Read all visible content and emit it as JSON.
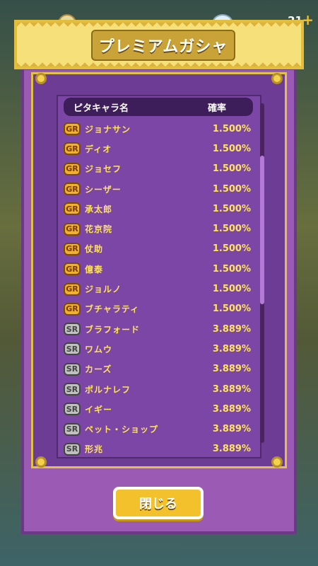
{
  "top": {
    "counter": "21"
  },
  "banner": {
    "title": "プレミアムガシャ"
  },
  "list": {
    "header_name": "ピタキャラ名",
    "header_rate": "確率",
    "items": [
      {
        "rank": "GR",
        "name": "ジョナサン",
        "rate": "1.500%"
      },
      {
        "rank": "GR",
        "name": "ディオ",
        "rate": "1.500%"
      },
      {
        "rank": "GR",
        "name": "ジョセフ",
        "rate": "1.500%"
      },
      {
        "rank": "GR",
        "name": "シーザー",
        "rate": "1.500%"
      },
      {
        "rank": "GR",
        "name": "承太郎",
        "rate": "1.500%"
      },
      {
        "rank": "GR",
        "name": "花京院",
        "rate": "1.500%"
      },
      {
        "rank": "GR",
        "name": "仗助",
        "rate": "1.500%"
      },
      {
        "rank": "GR",
        "name": "億泰",
        "rate": "1.500%"
      },
      {
        "rank": "GR",
        "name": "ジョルノ",
        "rate": "1.500%"
      },
      {
        "rank": "GR",
        "name": "ブチャラティ",
        "rate": "1.500%"
      },
      {
        "rank": "SR",
        "name": "ブラフォード",
        "rate": "3.889%"
      },
      {
        "rank": "SR",
        "name": "ワムウ",
        "rate": "3.889%"
      },
      {
        "rank": "SR",
        "name": "カーズ",
        "rate": "3.889%"
      },
      {
        "rank": "SR",
        "name": "ポルナレフ",
        "rate": "3.889%"
      },
      {
        "rank": "SR",
        "name": "イギー",
        "rate": "3.889%"
      },
      {
        "rank": "SR",
        "name": "ペット・ショップ",
        "rate": "3.889%"
      },
      {
        "rank": "SR",
        "name": "形兆",
        "rate": "3.889%"
      }
    ]
  },
  "close_button": {
    "label": "閉じる"
  },
  "colors": {
    "gold": "#f3c12b",
    "purple": "#6d3c94",
    "rate_text": "#ffe35a"
  }
}
